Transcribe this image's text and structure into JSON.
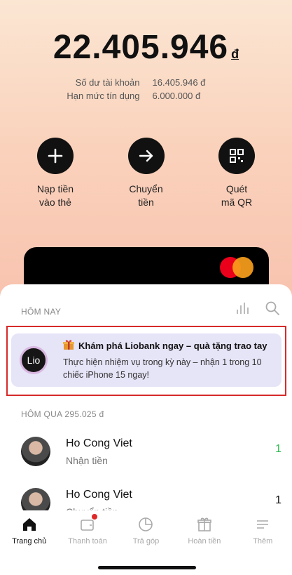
{
  "balance": {
    "amount": "22.405.946",
    "currency": "đ",
    "account_label": "Số dư tài khoản",
    "account_value": "16.405.946 đ",
    "credit_label": "Hạn mức tín dụng",
    "credit_value": "6.000.000 đ"
  },
  "actions": [
    {
      "label": "Nạp tiền\nvào thẻ",
      "icon": "plus-icon"
    },
    {
      "label": "Chuyển\ntiền",
      "icon": "arrow-right-icon"
    },
    {
      "label": "Quét\nmã QR",
      "icon": "qr-icon"
    }
  ],
  "card": {
    "brand_icon": "mastercard-icon",
    "colors": [
      "#eb001b",
      "#f79e1b"
    ]
  },
  "today": {
    "label": "HÔM NAY",
    "promo": {
      "logo": "Lio",
      "icon": "gift-icon",
      "title": "Khám phá Liobank ngay – quà tặng trao tay",
      "body": "Thực hiện nhiệm vụ trong kỳ này – nhận 1 trong 10 chiếc iPhone 15 ngay!"
    }
  },
  "yesterday": {
    "label": "HÔM QUA 295.025 đ",
    "transactions": [
      {
        "name": "Ho Cong Viet",
        "sub": "Nhận tiền",
        "amount": "1",
        "amount_color": "#2db84d"
      },
      {
        "name": "Ho Cong Viet",
        "sub": "Chuyển tiền",
        "amount": "1",
        "amount_color": "#111111"
      }
    ]
  },
  "nav": [
    {
      "label": "Trang chủ",
      "icon": "home-icon",
      "active": true
    },
    {
      "label": "Thanh toán",
      "icon": "wallet-icon",
      "badge": true
    },
    {
      "label": "Trả góp",
      "icon": "pie-chart-icon"
    },
    {
      "label": "Hoàn tiền",
      "icon": "gift-box-icon"
    },
    {
      "label": "Thêm",
      "icon": "menu-icon"
    }
  ],
  "colors": {
    "accent": "#111111",
    "highlight_border": "#d62a2a",
    "promo_bg": "#e6e4f7"
  }
}
